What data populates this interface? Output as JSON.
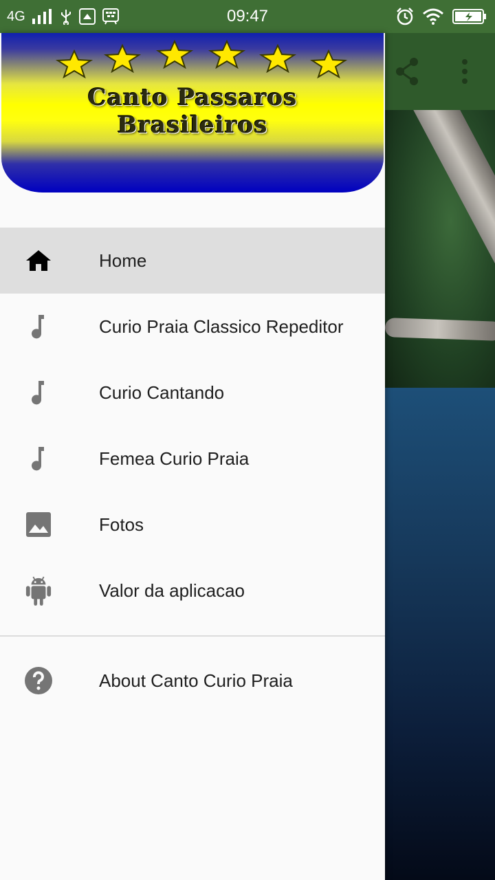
{
  "status_bar": {
    "network": "4G",
    "time": "09:47",
    "icons": [
      "signal-icon",
      "usb-icon",
      "app-update-icon",
      "bbm-icon",
      "alarm-icon",
      "wifi-icon",
      "battery-charging-icon"
    ]
  },
  "drawer": {
    "banner": {
      "title_line1": "Canto Passaros",
      "title_line2": "Brasileiros",
      "star_count": 6
    },
    "menu": [
      {
        "label": "Home",
        "icon": "home-icon",
        "active": true
      },
      {
        "label": "Curio Praia Classico Repeditor",
        "icon": "music-note-icon",
        "active": false
      },
      {
        "label": "Curio Cantando",
        "icon": "music-note-icon",
        "active": false
      },
      {
        "label": "Femea Curio Praia",
        "icon": "music-note-icon",
        "active": false
      },
      {
        "label": "Fotos",
        "icon": "image-icon",
        "active": false
      },
      {
        "label": "Valor da aplicacao",
        "icon": "android-icon",
        "active": false
      }
    ],
    "about": {
      "label": "About Canto Curio Praia",
      "icon": "help-icon"
    }
  },
  "toolbar": {
    "icons": [
      "share-icon",
      "more-vert-icon"
    ]
  },
  "colors": {
    "status_bar": "#3f6f35",
    "drawer_bg": "#fafafa",
    "active_item_bg": "#dedede",
    "icon_gray": "#757575",
    "text": "#1e1e1e"
  }
}
